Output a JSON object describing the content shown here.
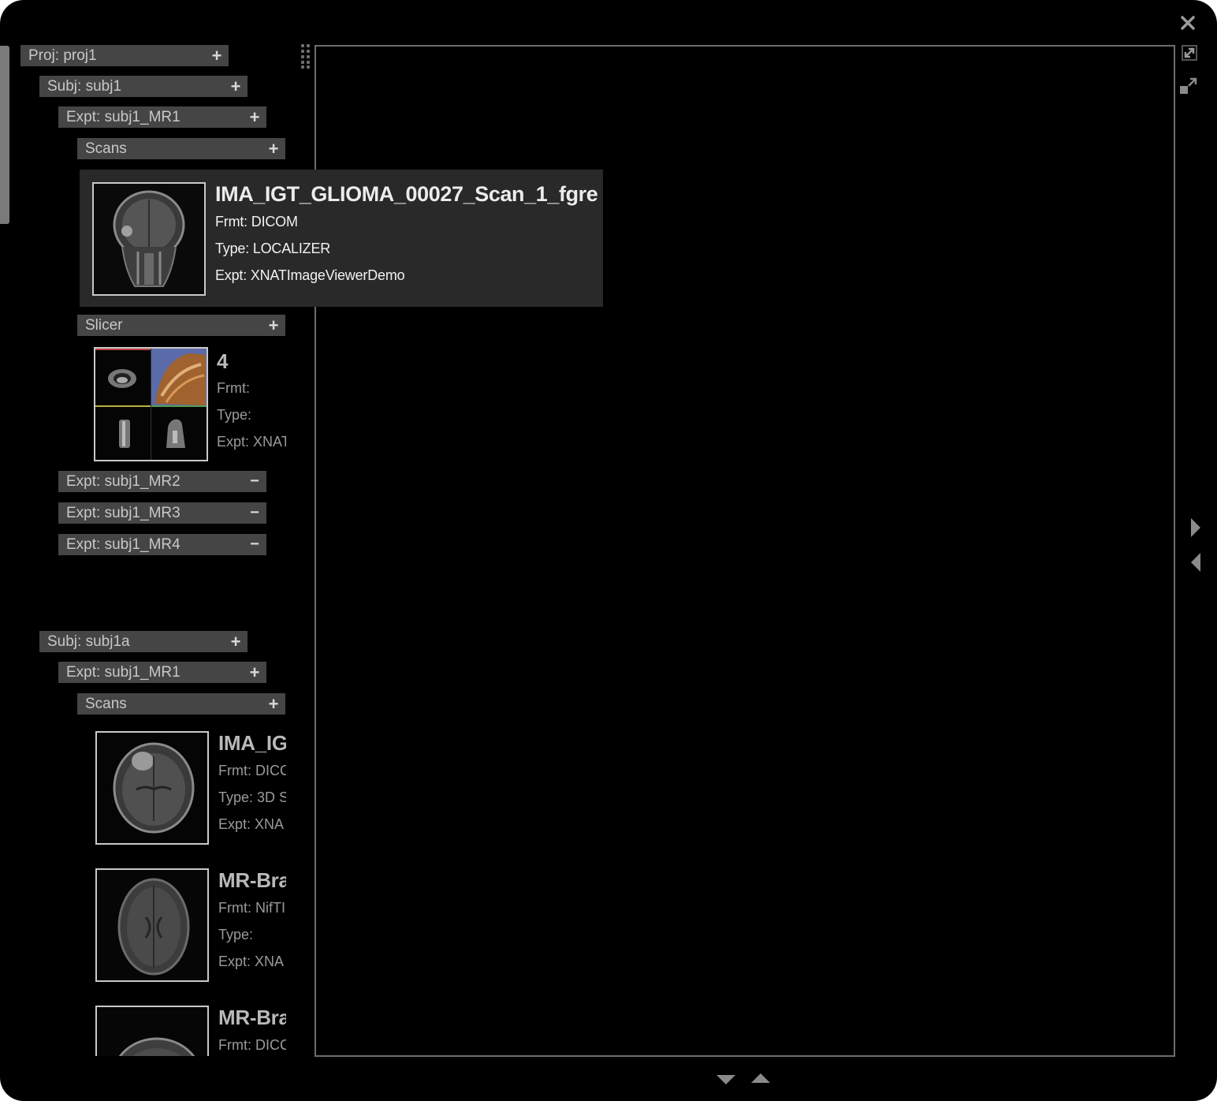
{
  "window": {
    "controls": {
      "close_icon": "close-icon",
      "expand_icon": "expand-icon",
      "collapse_icon": "collapse-icon"
    }
  },
  "tree": {
    "nodes": [
      {
        "label": "Proj: proj1",
        "toggle": "+"
      },
      {
        "label": "Subj: subj1",
        "toggle": "+"
      },
      {
        "label": "Expt: subj1_MR1",
        "toggle": "+"
      },
      {
        "label": "Scans",
        "toggle": "+"
      },
      {
        "label": "Slicer",
        "toggle": "+"
      },
      {
        "label": "Expt: subj1_MR2",
        "toggle": "−"
      },
      {
        "label": "Expt: subj1_MR3",
        "toggle": "−"
      },
      {
        "label": "Expt: subj1_MR4",
        "toggle": "−"
      },
      {
        "label": "Subj: subj1a",
        "toggle": "+"
      },
      {
        "label": "Expt: subj1_MR1",
        "toggle": "+"
      },
      {
        "label": "Scans",
        "toggle": "+"
      }
    ],
    "thumbnails": [
      {
        "title": "4",
        "frmt": "Frmt:",
        "type": "Type:",
        "expt": "Expt: XNATIm"
      },
      {
        "title": "IMA_IG",
        "frmt": "Frmt: DICC",
        "type": "Type: 3D S",
        "expt": "Expt: XNA"
      },
      {
        "title": "MR-Bra",
        "frmt": "Frmt: NifTI",
        "type": "Type:",
        "expt": "Expt: XNA"
      },
      {
        "title": "MR-Bra",
        "frmt": "Frmt: DICC"
      }
    ]
  },
  "popup": {
    "title": "IMA_IGT_GLIOMA_00027_Scan_1_fgre",
    "frmt": "Frmt: DICOM",
    "type": "Type: LOCALIZER",
    "expt": "Expt: XNATImageViewerDemo"
  },
  "nav": {
    "next_icon": "arrow-right-icon",
    "prev_icon": "arrow-left-icon",
    "down_icon": "arrow-down-icon",
    "up_icon": "arrow-up-icon"
  },
  "colors": {
    "background": "#000000",
    "bar": "#454545",
    "popup": "#292929",
    "viewer_border": "#6d6d6d"
  }
}
